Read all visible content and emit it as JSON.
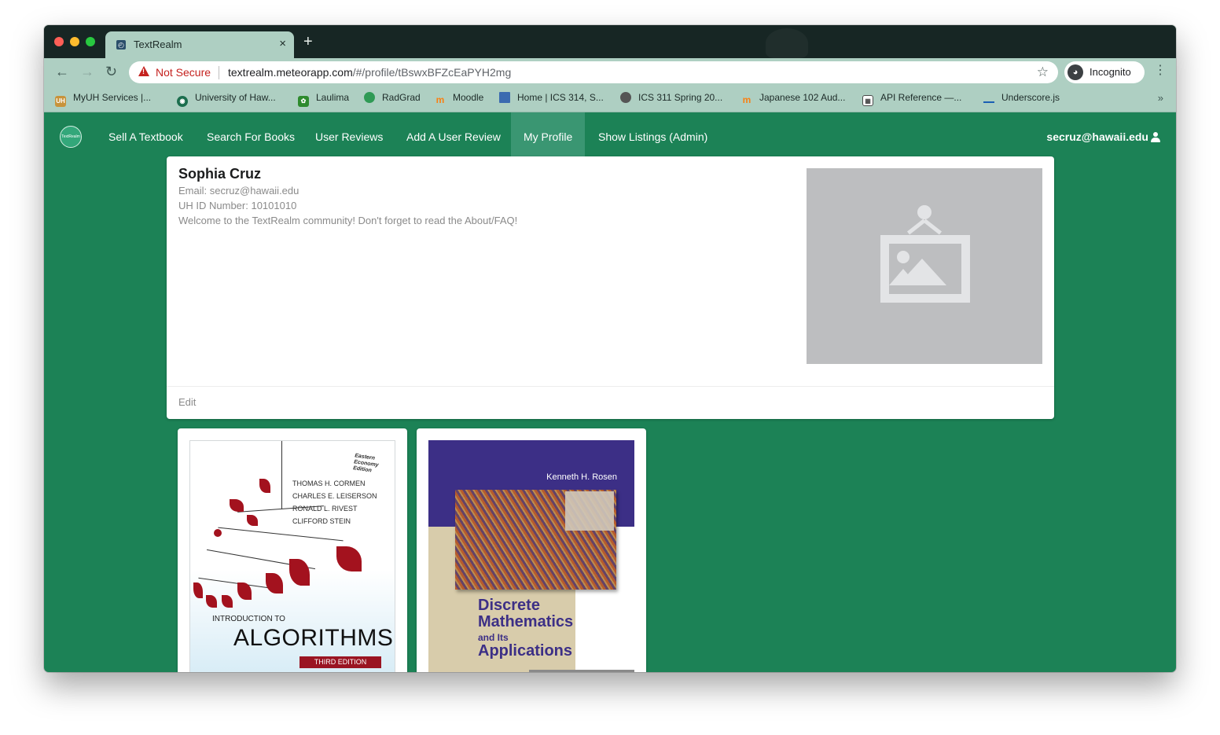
{
  "browser": {
    "tab_title": "TextRealm",
    "tab_close": "×",
    "new_tab": "+",
    "security_label": "Not Secure",
    "url_host": "textrealm.meteorapp.com",
    "url_path": "/#/profile/tBswxBFZcEaPYH2mg",
    "incognito_label": "Incognito",
    "bookmarks": [
      {
        "label": "MyUH Services |...",
        "icon": "uh-icon",
        "color": "#c8933b"
      },
      {
        "label": "University of Haw...",
        "icon": "uh-seal-icon",
        "color": "#1c6e4e"
      },
      {
        "label": "Laulima",
        "icon": "laulima-leaf-icon",
        "color": "#2e8b2e"
      },
      {
        "label": "RadGrad",
        "icon": "radgrad-icon",
        "color": "#2f9a55"
      },
      {
        "label": "Moodle",
        "icon": "moodle-icon",
        "color": "#f98012"
      },
      {
        "label": "Home | ICS 314, S...",
        "icon": "blue-square-icon",
        "color": "#3b6bb0"
      },
      {
        "label": "ICS 311 Spring 20...",
        "icon": "globe-icon",
        "color": "#555555"
      },
      {
        "label": "Japanese 102 Aud...",
        "icon": "moodle-icon",
        "color": "#f98012"
      },
      {
        "label": "API Reference —...",
        "icon": "doc-grid-icon",
        "color": "#4a4a4a"
      },
      {
        "label": "Underscore.js",
        "icon": "underscore-icon",
        "color": "#1a5fb4"
      }
    ],
    "bookmarks_more": "»"
  },
  "navbar": {
    "logo_text": "TextRealm",
    "items": [
      {
        "label": "Sell A Textbook"
      },
      {
        "label": "Search For Books"
      },
      {
        "label": "User Reviews"
      },
      {
        "label": "Add A User Review"
      },
      {
        "label": "My Profile",
        "active": true
      },
      {
        "label": "Show Listings (Admin)"
      }
    ],
    "user_email": "secruz@hawaii.edu"
  },
  "profile": {
    "name": "Sophia Cruz",
    "email_line": "Email: secruz@hawaii.edu",
    "id_line": "UH ID Number: 10101010",
    "welcome": "Welcome to the TextRealm community! Don't forget to read the About/FAQ!",
    "edit_label": "Edit"
  },
  "books": [
    {
      "edition_note": "Eastern Economy Edition",
      "authors": [
        "THOMAS H. CORMEN",
        "CHARLES E. LEISERSON",
        "RONALD L. RIVEST",
        "CLIFFORD STEIN"
      ],
      "intro": "INTRODUCTION TO",
      "title": "ALGORITHMS",
      "edition": "THIRD EDITION"
    },
    {
      "author": "Kenneth H. Rosen",
      "title_line1": "Discrete",
      "title_line2": "Mathematics",
      "title_line3": "and Its",
      "title_line4": "Applications"
    }
  ],
  "colors": {
    "app_green": "#1c8256",
    "nav_active": "#3a9672",
    "browser_chrome": "#aecfc2",
    "warning_red": "#c5221f"
  }
}
